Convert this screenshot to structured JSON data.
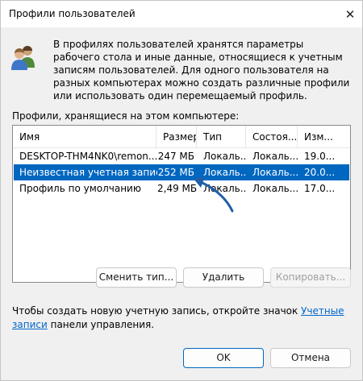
{
  "window": {
    "title": "Профили пользователей",
    "close_glyph": "✕"
  },
  "intro": {
    "text": "В профилях пользователей хранятся параметры рабочего стола и иные данные, относящиеся к учетным записям пользователей. Для одного пользователя на разных компьютерах можно создать различные профили или использовать один перемещаемый профиль."
  },
  "profiles": {
    "label": "Профили, хранящиеся на этом компьютере:",
    "columns": [
      "Имя",
      "Размер",
      "Тип",
      "Состоя...",
      "Изм..."
    ],
    "rows": [
      {
        "name": "DESKTOP-THM4NK0\\remon...",
        "size": "247 МБ",
        "type": "Локаль...",
        "status": "Локаль...",
        "modified": "19.0...",
        "selected": false
      },
      {
        "name": "Неизвестная учетная запись",
        "size": "252 МБ",
        "type": "Локаль...",
        "status": "Локаль...",
        "modified": "20.0...",
        "selected": true
      },
      {
        "name": "Профиль по умолчанию",
        "size": "2,49 МБ",
        "type": "Локаль...",
        "status": "Локаль...",
        "modified": "17.0...",
        "selected": false
      }
    ]
  },
  "buttons": {
    "change_type": "Сменить тип...",
    "delete": "Удалить",
    "copy": "Копировать...",
    "ok": "OK",
    "cancel": "Отмена"
  },
  "footer": {
    "text_before": "Чтобы создать новую учетную запись, откройте значок ",
    "link": "Учетные записи",
    "text_after": " панели управления."
  },
  "colors": {
    "selection": "#0067c0",
    "link": "#0066cc",
    "annotation_arrow": "#1f5fa8"
  }
}
